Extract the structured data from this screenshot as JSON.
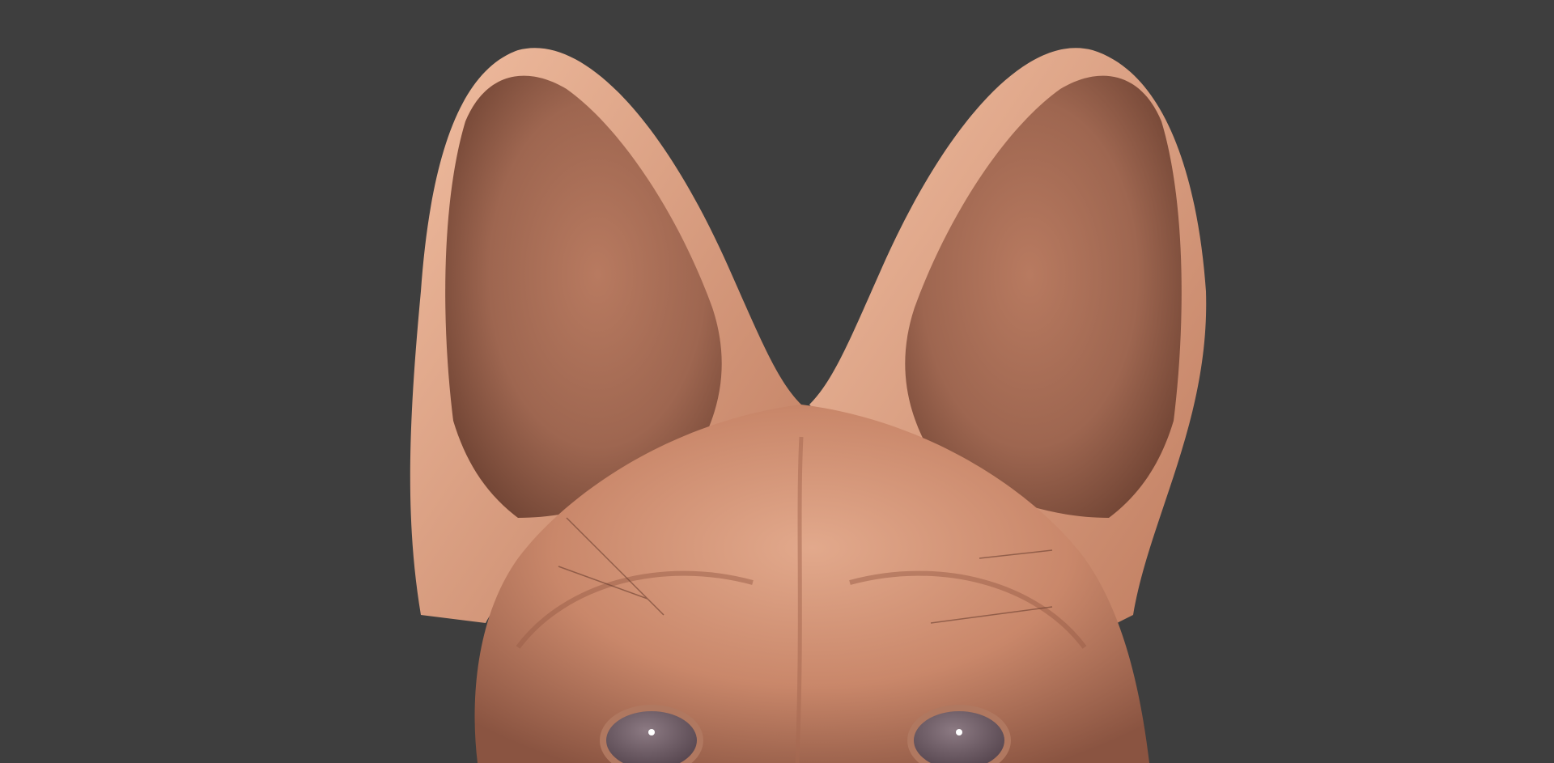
{
  "scene": {
    "subject": "sculpted-dog-head-render",
    "background_color": "#3e3e3e",
    "skin_base_color": "#c9876a",
    "skin_light_color": "#e2a98c",
    "skin_shadow_color": "#8a5441",
    "inner_ear_color": "#9e6650",
    "eye_color": "#6b5a63"
  }
}
